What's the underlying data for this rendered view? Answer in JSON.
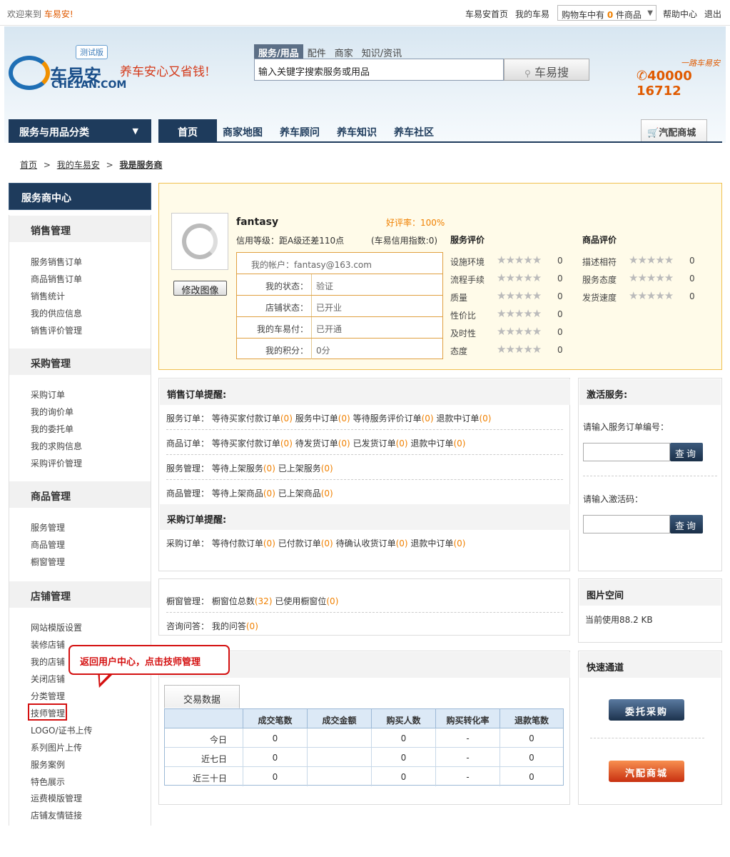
{
  "topbar": {
    "welcome": "欢迎来到",
    "brand": "车易安!",
    "links": [
      "车易安首页",
      "我的车易"
    ],
    "cart_prefix": "购物车中有",
    "cart_count": "0",
    "cart_suffix": "件商品",
    "help": "帮助中心",
    "logout": "退出"
  },
  "header": {
    "logo_cn": "车易安",
    "logo_en": "CHE1AN.COM",
    "beta": "测试版",
    "slogan": "养车安心又省钱!",
    "search_tabs": [
      "服务/用品",
      "配件",
      "商家",
      "知识/资讯"
    ],
    "search_value": "输入关键字搜索服务或用品",
    "search_button": "车易搜",
    "hotline_tag": "一路车易安",
    "hotline": "40000 16712"
  },
  "nav": {
    "category": "服务与用品分类",
    "items": [
      "首页",
      "商家地图",
      "养车顾问",
      "养车知识",
      "养车社区"
    ],
    "mall": "汽配商城"
  },
  "breadcrumb": {
    "home": "首页",
    "mine": "我的车易安",
    "current": "我是服务商",
    "sep": ">"
  },
  "sidebar": {
    "title": "服务商中心",
    "sections": [
      {
        "title": "销售管理",
        "links": [
          "服务销售订单",
          "商品销售订单",
          "销售统计",
          "我的供应信息",
          "销售评价管理"
        ]
      },
      {
        "title": "采购管理",
        "links": [
          "采购订单",
          "我的询价单",
          "我的委托单",
          "我的求购信息",
          "采购评价管理"
        ]
      },
      {
        "title": "商品管理",
        "links": [
          "服务管理",
          "商品管理",
          "橱窗管理"
        ]
      },
      {
        "title": "店铺管理",
        "links": [
          "网站模版设置",
          "装修店铺",
          "我的店铺",
          "关闭店铺",
          "分类管理",
          "技师管理",
          "LOGO/证书上传",
          "系列图片上传",
          "服务案例",
          "特色展示",
          "运费模版管理",
          "店铺友情链接"
        ]
      }
    ]
  },
  "tooltip": "返回用户中心，点击技师管理",
  "profile": {
    "edit_image": "修改图像",
    "username": "fantasy",
    "good_rate": "好评率：100%",
    "credit": "信用等级：距A级还差110点",
    "credit_index": "(车易信用指数:0)",
    "account_label": "我的帐户：",
    "account": "fantasy@163.com",
    "rows": [
      {
        "k": "我的状态：",
        "v": "验证"
      },
      {
        "k": "店铺状态：",
        "v": "已开业"
      },
      {
        "k": "我的车易付：",
        "v": "已开通"
      },
      {
        "k": "我的积分：",
        "v": "0分"
      }
    ],
    "service_title": "服务评价",
    "service_ratings": [
      {
        "label": "设施环境",
        "score": "0"
      },
      {
        "label": "流程手续",
        "score": "0"
      },
      {
        "label": "质量",
        "score": "0"
      },
      {
        "label": "性价比",
        "score": "0"
      },
      {
        "label": "及时性",
        "score": "0"
      },
      {
        "label": "态度",
        "score": "0"
      }
    ],
    "goods_title": "商品评价",
    "goods_ratings": [
      {
        "label": "描述相符",
        "score": "0"
      },
      {
        "label": "服务态度",
        "score": "0"
      },
      {
        "label": "发货速度",
        "score": "0"
      }
    ]
  },
  "sales": {
    "title": "销售订单提醒:",
    "rows": [
      {
        "label": "服务订单：",
        "items": [
          [
            "等待买家付款订单",
            "0"
          ],
          [
            "服务中订单",
            "0"
          ],
          [
            "等待服务评价订单",
            "0"
          ],
          [
            "退款中订单",
            "0"
          ]
        ]
      },
      {
        "label": "商品订单：",
        "items": [
          [
            "等待买家付款订单",
            "0"
          ],
          [
            "待发货订单",
            "0"
          ],
          [
            "已发货订单",
            "0"
          ],
          [
            "退款中订单",
            "0"
          ]
        ]
      },
      {
        "label": "服务管理：",
        "items": [
          [
            "等待上架服务",
            "0"
          ],
          [
            "已上架服务",
            "0"
          ]
        ]
      },
      {
        "label": "商品管理：",
        "items": [
          [
            "等待上架商品",
            "0"
          ],
          [
            "已上架商品",
            "0"
          ]
        ]
      }
    ],
    "purchase_title": "采购订单提醒:",
    "purchase_row": {
      "label": "采购订单：",
      "items": [
        [
          "等待付款订单",
          "0"
        ],
        [
          "已付款订单",
          "0"
        ],
        [
          "待确认收货订单",
          "0"
        ],
        [
          "退款中订单",
          "0"
        ]
      ]
    }
  },
  "activate": {
    "title": "激活服务:",
    "order_label": "请输入服务订单编号：",
    "code_label": "请输入激活码：",
    "query": "查询"
  },
  "window": {
    "row1": {
      "label": "橱窗管理：",
      "items": [
        [
          "橱窗位总数",
          "32"
        ],
        [
          "已使用橱窗位",
          "0"
        ]
      ]
    },
    "row2": {
      "label": "咨询问答：",
      "items": [
        [
          "我的问答",
          "0"
        ]
      ]
    }
  },
  "image_space": {
    "title": "图片空间",
    "usage": "当前使用88.2 KB"
  },
  "quick": {
    "title": "快速通道",
    "btn1": "委托采购",
    "btn2": "汽配商城"
  },
  "trade": {
    "tab": "交易数据",
    "headers": [
      "",
      "成交笔数",
      "成交金额",
      "购买人数",
      "购买转化率",
      "退款笔数"
    ],
    "rows": [
      [
        "今日",
        "0",
        "",
        "0",
        "-",
        "0"
      ],
      [
        "近七日",
        "0",
        "",
        "0",
        "-",
        "0"
      ],
      [
        "近三十日",
        "0",
        "",
        "0",
        "-",
        "0"
      ]
    ]
  },
  "colors": {
    "nav": "#1e3b5c",
    "accent": "#f08000",
    "highlight": "#d41010",
    "profile_bg": "#fffbe9"
  }
}
